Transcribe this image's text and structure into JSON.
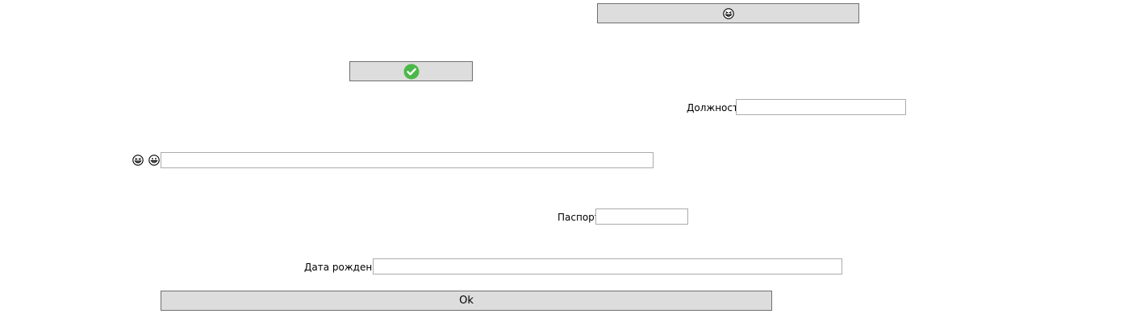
{
  "top_button": {
    "icon": "grinning-squint-face-icon"
  },
  "confirm_button": {
    "icon": "green-checkmark-icon",
    "accent": "#4cb848"
  },
  "position_field": {
    "label": "Должность",
    "value": ""
  },
  "name_field": {
    "icons": [
      "grinning-squint-face-icon",
      "grinning-face-icon"
    ],
    "value": ""
  },
  "passport_field": {
    "label": "Паспорт",
    "value": ""
  },
  "birthdate_field": {
    "label": "Дата рождения",
    "value": ""
  },
  "ok_button": {
    "label": "Ok"
  }
}
